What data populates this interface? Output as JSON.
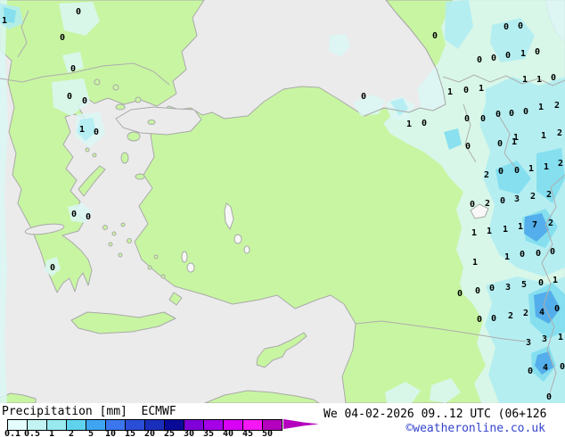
{
  "map": {
    "palette": {
      "sea": "#EBEBEB",
      "land": "#C8F5A2",
      "coast": "#A9A9A9",
      "lake": "#F8F8F8",
      "precip_01": "#DBF7F5",
      "precip_05": "#AFECF2",
      "precip_2": "#7CDCEE",
      "precip_5": "#4BA6EA"
    },
    "values": [
      [
        5,
        24,
        "1"
      ],
      [
        88,
        14,
        "0"
      ],
      [
        70,
        43,
        "0"
      ],
      [
        82,
        78,
        "0"
      ],
      [
        78,
        109,
        "0"
      ],
      [
        95,
        114,
        "0"
      ],
      [
        92,
        146,
        "1"
      ],
      [
        108,
        149,
        "0"
      ],
      [
        83,
        241,
        "0"
      ],
      [
        99,
        244,
        "0"
      ],
      [
        59,
        301,
        "0"
      ],
      [
        408,
        109,
        "0"
      ],
      [
        488,
        41,
        "0"
      ],
      [
        459,
        140,
        "1"
      ],
      [
        476,
        139,
        "0"
      ],
      [
        568,
        31,
        "0"
      ],
      [
        584,
        30,
        "0"
      ],
      [
        538,
        68,
        "0"
      ],
      [
        554,
        66,
        "0"
      ],
      [
        570,
        63,
        "0"
      ],
      [
        587,
        61,
        "1"
      ],
      [
        603,
        59,
        "0"
      ],
      [
        589,
        90,
        "1"
      ],
      [
        605,
        90,
        "1"
      ],
      [
        621,
        88,
        "0"
      ],
      [
        505,
        104,
        "1"
      ],
      [
        523,
        102,
        "0"
      ],
      [
        540,
        100,
        "1"
      ],
      [
        524,
        134,
        "0"
      ],
      [
        542,
        134,
        "0"
      ],
      [
        559,
        129,
        "0"
      ],
      [
        574,
        128,
        "0"
      ],
      [
        590,
        126,
        "0"
      ],
      [
        607,
        121,
        "1"
      ],
      [
        625,
        119,
        "2"
      ],
      [
        579,
        155,
        "1"
      ],
      [
        610,
        153,
        "1"
      ],
      [
        628,
        150,
        "2"
      ],
      [
        525,
        165,
        "0"
      ],
      [
        561,
        162,
        "0"
      ],
      [
        577,
        160,
        "1"
      ],
      [
        546,
        197,
        "2"
      ],
      [
        562,
        193,
        "0"
      ],
      [
        580,
        192,
        "0"
      ],
      [
        596,
        190,
        "1"
      ],
      [
        613,
        188,
        "1"
      ],
      [
        629,
        184,
        "2"
      ],
      [
        530,
        230,
        "0"
      ],
      [
        547,
        229,
        "2"
      ],
      [
        564,
        226,
        "0"
      ],
      [
        580,
        224,
        "3"
      ],
      [
        598,
        221,
        "2"
      ],
      [
        616,
        219,
        "2"
      ],
      [
        532,
        262,
        "1"
      ],
      [
        549,
        260,
        "1"
      ],
      [
        567,
        258,
        "1"
      ],
      [
        584,
        255,
        "1"
      ],
      [
        600,
        253,
        "7"
      ],
      [
        618,
        251,
        "2"
      ],
      [
        533,
        295,
        "1"
      ],
      [
        569,
        289,
        "1"
      ],
      [
        586,
        286,
        "0"
      ],
      [
        604,
        285,
        "0"
      ],
      [
        620,
        283,
        "0"
      ],
      [
        516,
        330,
        "0"
      ],
      [
        536,
        327,
        "0"
      ],
      [
        552,
        324,
        "0"
      ],
      [
        570,
        323,
        "3"
      ],
      [
        588,
        320,
        "5"
      ],
      [
        607,
        318,
        "0"
      ],
      [
        623,
        315,
        "1"
      ],
      [
        538,
        359,
        "0"
      ],
      [
        554,
        358,
        "0"
      ],
      [
        573,
        355,
        "2"
      ],
      [
        590,
        352,
        "2"
      ],
      [
        608,
        351,
        "4"
      ],
      [
        625,
        347,
        "0"
      ],
      [
        593,
        385,
        "3"
      ],
      [
        611,
        381,
        "3"
      ],
      [
        629,
        379,
        "1"
      ],
      [
        595,
        417,
        "0"
      ],
      [
        612,
        413,
        "4"
      ],
      [
        631,
        412,
        "0"
      ],
      [
        616,
        446,
        "0"
      ]
    ]
  },
  "legend": {
    "title": "Precipitation [mm]  ECMWF",
    "scale": [
      {
        "label": "0.1",
        "color": "#E4FCFC"
      },
      {
        "label": "0.5",
        "color": "#C2F4F4"
      },
      {
        "label": "1",
        "color": "#98EAF0"
      },
      {
        "label": "2",
        "color": "#5FD3EE"
      },
      {
        "label": "5",
        "color": "#3FA5F2"
      },
      {
        "label": "10",
        "color": "#3B76EE"
      },
      {
        "label": "15",
        "color": "#2A4ED8"
      },
      {
        "label": "20",
        "color": "#1A2EBC"
      },
      {
        "label": "25",
        "color": "#0A0A99"
      },
      {
        "label": "30",
        "color": "#8000D8"
      },
      {
        "label": "35",
        "color": "#A500E8"
      },
      {
        "label": "40",
        "color": "#D800F5"
      },
      {
        "label": "45",
        "color": "#F518F5"
      },
      {
        "label": "50",
        "color": "#B400BE"
      }
    ],
    "arrow_color": "#B400BE"
  },
  "footer": {
    "valid": "We 04-02-2026 09..12 UTC (06+126",
    "credit": "©weatheronline.co.uk"
  }
}
